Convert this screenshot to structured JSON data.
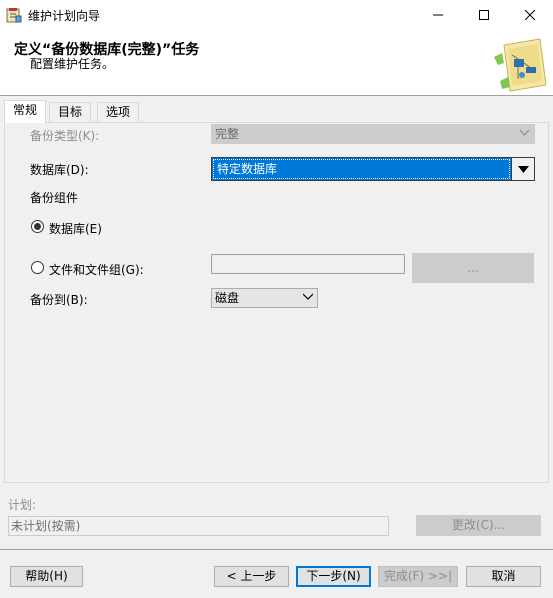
{
  "window": {
    "title": "维护计划向导",
    "app_icon": "wizard-app-icon",
    "controls": [
      "minimize-icon",
      "maximize-icon",
      "close-icon"
    ]
  },
  "header": {
    "title": "定义“备份数据库(完整)”任务",
    "subtitle": "配置维护任务。",
    "image": "wizard-graphic-icon"
  },
  "tabs": [
    {
      "label": "常规",
      "active": true
    },
    {
      "label": "目标",
      "active": false
    },
    {
      "label": "选项",
      "active": false
    }
  ],
  "general": {
    "backup_type_label": "备份类型(K):",
    "backup_type_value": "完整",
    "database_label": "数据库(D):",
    "database_value": "特定数据库",
    "backup_component_label": "备份组件",
    "radio_database_label": "数据库(E)",
    "radio_files_label": "文件和文件组(G):",
    "files_value": "",
    "browse_label": "...",
    "backup_to_label": "备份到(B):",
    "backup_to_value": "磁盘"
  },
  "schedule": {
    "label": "计划:",
    "value": "未计划(按需)",
    "change_label": "更改(C)..."
  },
  "footer": {
    "help": "帮助(H)",
    "back": "< 上一步",
    "next": "下一步(N)",
    "finish": "完成(F) >>|",
    "cancel": "取消"
  },
  "colors": {
    "selection": "#0078d7",
    "disabled_bg": "#cccccc",
    "dialog_bg": "#f0f0f0"
  }
}
